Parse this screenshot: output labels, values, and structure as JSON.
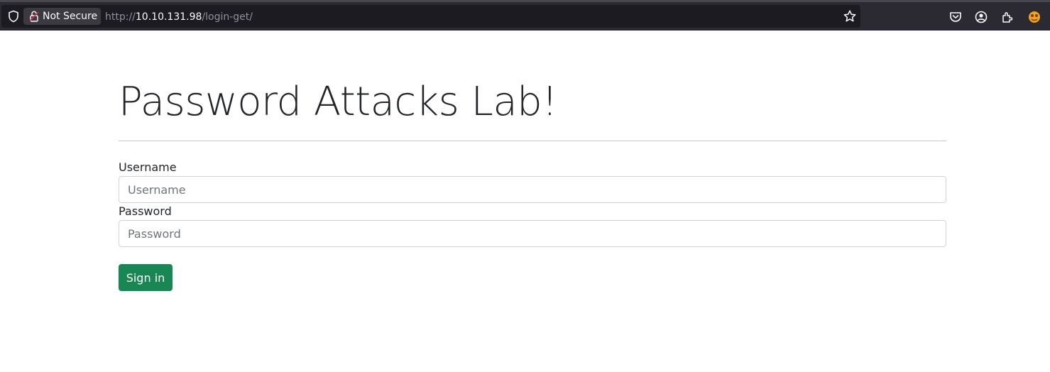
{
  "browser": {
    "security_label": "Not Secure",
    "url_scheme": "http://",
    "url_host": "10.10.131.98",
    "url_path": "/login-get/",
    "icons": [
      "shield-icon",
      "lock-broken-icon",
      "star-icon",
      "pocket-icon",
      "account-icon",
      "extensions-icon",
      "profile-avatar-icon"
    ]
  },
  "page": {
    "title": "Password Attacks Lab!",
    "form": {
      "username_label": "Username",
      "username_placeholder": "Username",
      "username_value": "",
      "password_label": "Password",
      "password_placeholder": "Password",
      "password_value": "",
      "submit_label": "Sign in"
    }
  },
  "colors": {
    "chrome_bg": "#2b2a33",
    "urlbar_bg": "#1c1b22",
    "button_bg": "#198754",
    "text": "#212529"
  }
}
